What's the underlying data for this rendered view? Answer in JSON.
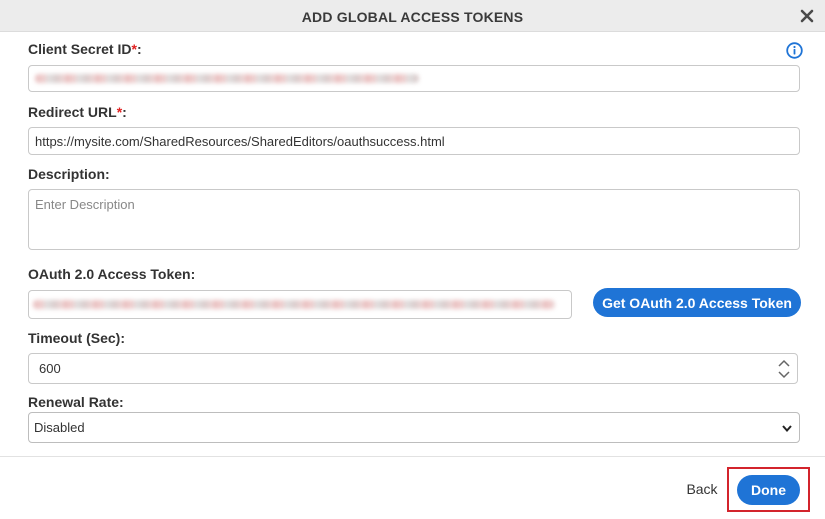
{
  "dialog": {
    "title": "ADD GLOBAL ACCESS TOKENS",
    "close_icon": "close-icon",
    "info_icon": "info-icon"
  },
  "fields": {
    "client_secret_id": {
      "label": "Client Secret ID",
      "required_mark": "*",
      "suffix": ":"
    },
    "redirect_url": {
      "label": "Redirect URL",
      "required_mark": "*",
      "suffix": ":",
      "value": "https://mysite.com/SharedResources/SharedEditors/oauthsuccess.html"
    },
    "description": {
      "label": "Description:",
      "placeholder": "Enter Description"
    },
    "oauth_token": {
      "label": "OAuth 2.0 Access Token:",
      "button_label": "Get OAuth 2.0 Access Token"
    },
    "timeout": {
      "label": "Timeout (Sec):",
      "value": "600"
    },
    "renewal_rate": {
      "label": "Renewal Rate:",
      "selected": "Disabled"
    }
  },
  "footer": {
    "back_label": "Back",
    "done_label": "Done"
  },
  "colors": {
    "primary": "#1f74d6",
    "required": "#e02020",
    "highlight": "#d3242c"
  }
}
